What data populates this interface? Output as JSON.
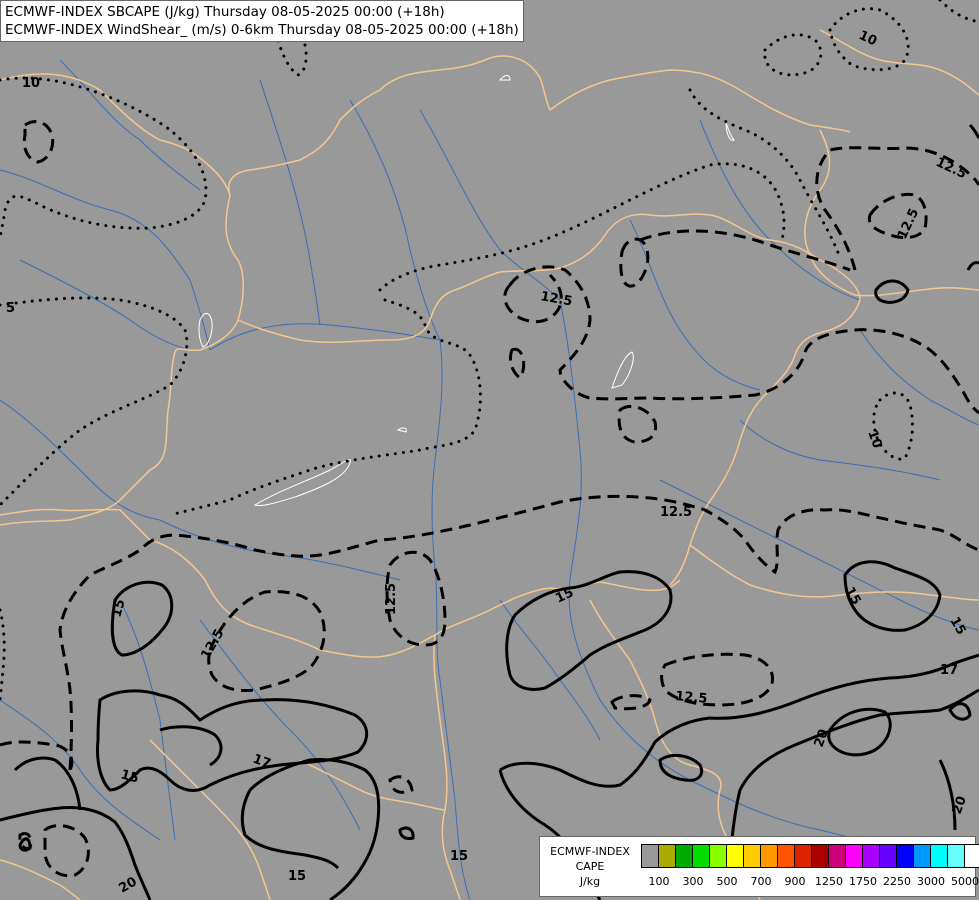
{
  "title": {
    "line1": "ECMWF-INDEX SBCAPE (J/kg) Thursday 08-05-2025 00:00 (+18h)",
    "line2": "ECMWF-INDEX WindShear_ (m/s) 0-6km Thursday 08-05-2025 00:00 (+18h)"
  },
  "legend": {
    "line1": "ECMWF-INDEX",
    "line2": "CAPE",
    "line3": "J/kg",
    "colors": [
      "#999999",
      "#aaaa00",
      "#00aa00",
      "#00dd00",
      "#88ff00",
      "#ffff00",
      "#ffcc00",
      "#ff9900",
      "#ff5500",
      "#dd2200",
      "#aa0000",
      "#cc0077",
      "#ff00ff",
      "#aa00ff",
      "#6600ff",
      "#0000ff",
      "#0099ff",
      "#00ffff",
      "#66ffff",
      "#ffffff"
    ],
    "ticks": [
      "100",
      "300",
      "500",
      "700",
      "900",
      "1250",
      "1750",
      "2250",
      "3000",
      "5000"
    ]
  },
  "map": {
    "background": "#999999",
    "border_color": "#f2c78f",
    "river_color": "#3a6fb5",
    "contour_labels": [
      "10",
      "10",
      "5",
      "10",
      "12.5",
      "12.5",
      "12.5",
      "12.5",
      "12.5",
      "12.5",
      "12.5",
      "15",
      "15",
      "15",
      "15",
      "15",
      "15",
      "15",
      "17",
      "17",
      "20",
      "20",
      "20"
    ]
  }
}
